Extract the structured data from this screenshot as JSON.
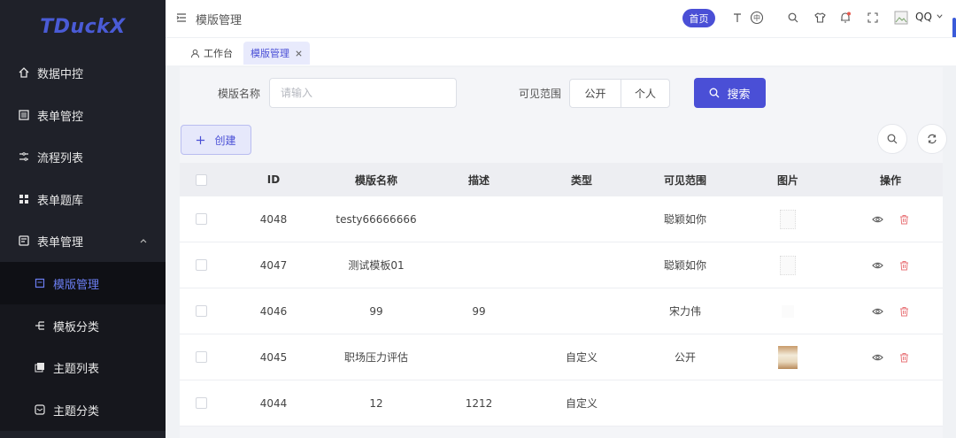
{
  "app": {
    "logo": "TDuckX"
  },
  "sidebar": {
    "items": [
      {
        "label": "数据中控",
        "icon": "home-icon"
      },
      {
        "label": "表单管控",
        "icon": "form-icon"
      },
      {
        "label": "流程列表",
        "icon": "flow-icon"
      },
      {
        "label": "表单题库",
        "icon": "grid-icon"
      },
      {
        "label": "表单管理",
        "icon": "form-manage-icon"
      }
    ],
    "sub_items": [
      {
        "label": "模版管理",
        "icon": "template-icon",
        "active": true
      },
      {
        "label": "模板分类",
        "icon": "category-icon"
      },
      {
        "label": "主题列表",
        "icon": "theme-list-icon"
      },
      {
        "label": "主题分类",
        "icon": "theme-category-icon"
      }
    ]
  },
  "topbar": {
    "title": "模版管理",
    "home_label": "首页",
    "user_name": "QQ"
  },
  "tabs": [
    {
      "label": "工作台",
      "icon": "user-icon"
    },
    {
      "label": "模版管理",
      "active": true
    }
  ],
  "search": {
    "name_label": "模版名称",
    "name_placeholder": "请输入",
    "scope_label": "可见范围",
    "scope_options": [
      "公开",
      "个人"
    ],
    "search_button": "搜索"
  },
  "toolbar": {
    "create_label": "创建"
  },
  "table": {
    "columns": [
      "ID",
      "模版名称",
      "描述",
      "类型",
      "可见范围",
      "图片",
      "操作"
    ],
    "rows": [
      {
        "id": "4048",
        "name": "testy66666666",
        "desc": "",
        "type": "",
        "scope": "聪颖如你",
        "thumb": "blank"
      },
      {
        "id": "4047",
        "name": "测试模板01",
        "desc": "",
        "type": "",
        "scope": "聪颖如你",
        "thumb": "blank"
      },
      {
        "id": "4046",
        "name": "99",
        "desc": "99",
        "type": "",
        "scope": "宋力伟",
        "thumb": "blank"
      },
      {
        "id": "4045",
        "name": "职场压力评估",
        "desc": "",
        "type": "自定义",
        "scope": "公开",
        "thumb": "image"
      },
      {
        "id": "4044",
        "name": "12",
        "desc": "1212",
        "type": "自定义",
        "scope": "",
        "thumb": "none"
      }
    ]
  },
  "colors": {
    "accent": "#4a4fd6",
    "sidebar_bg": "#1f2129",
    "danger": "#e8767a"
  }
}
